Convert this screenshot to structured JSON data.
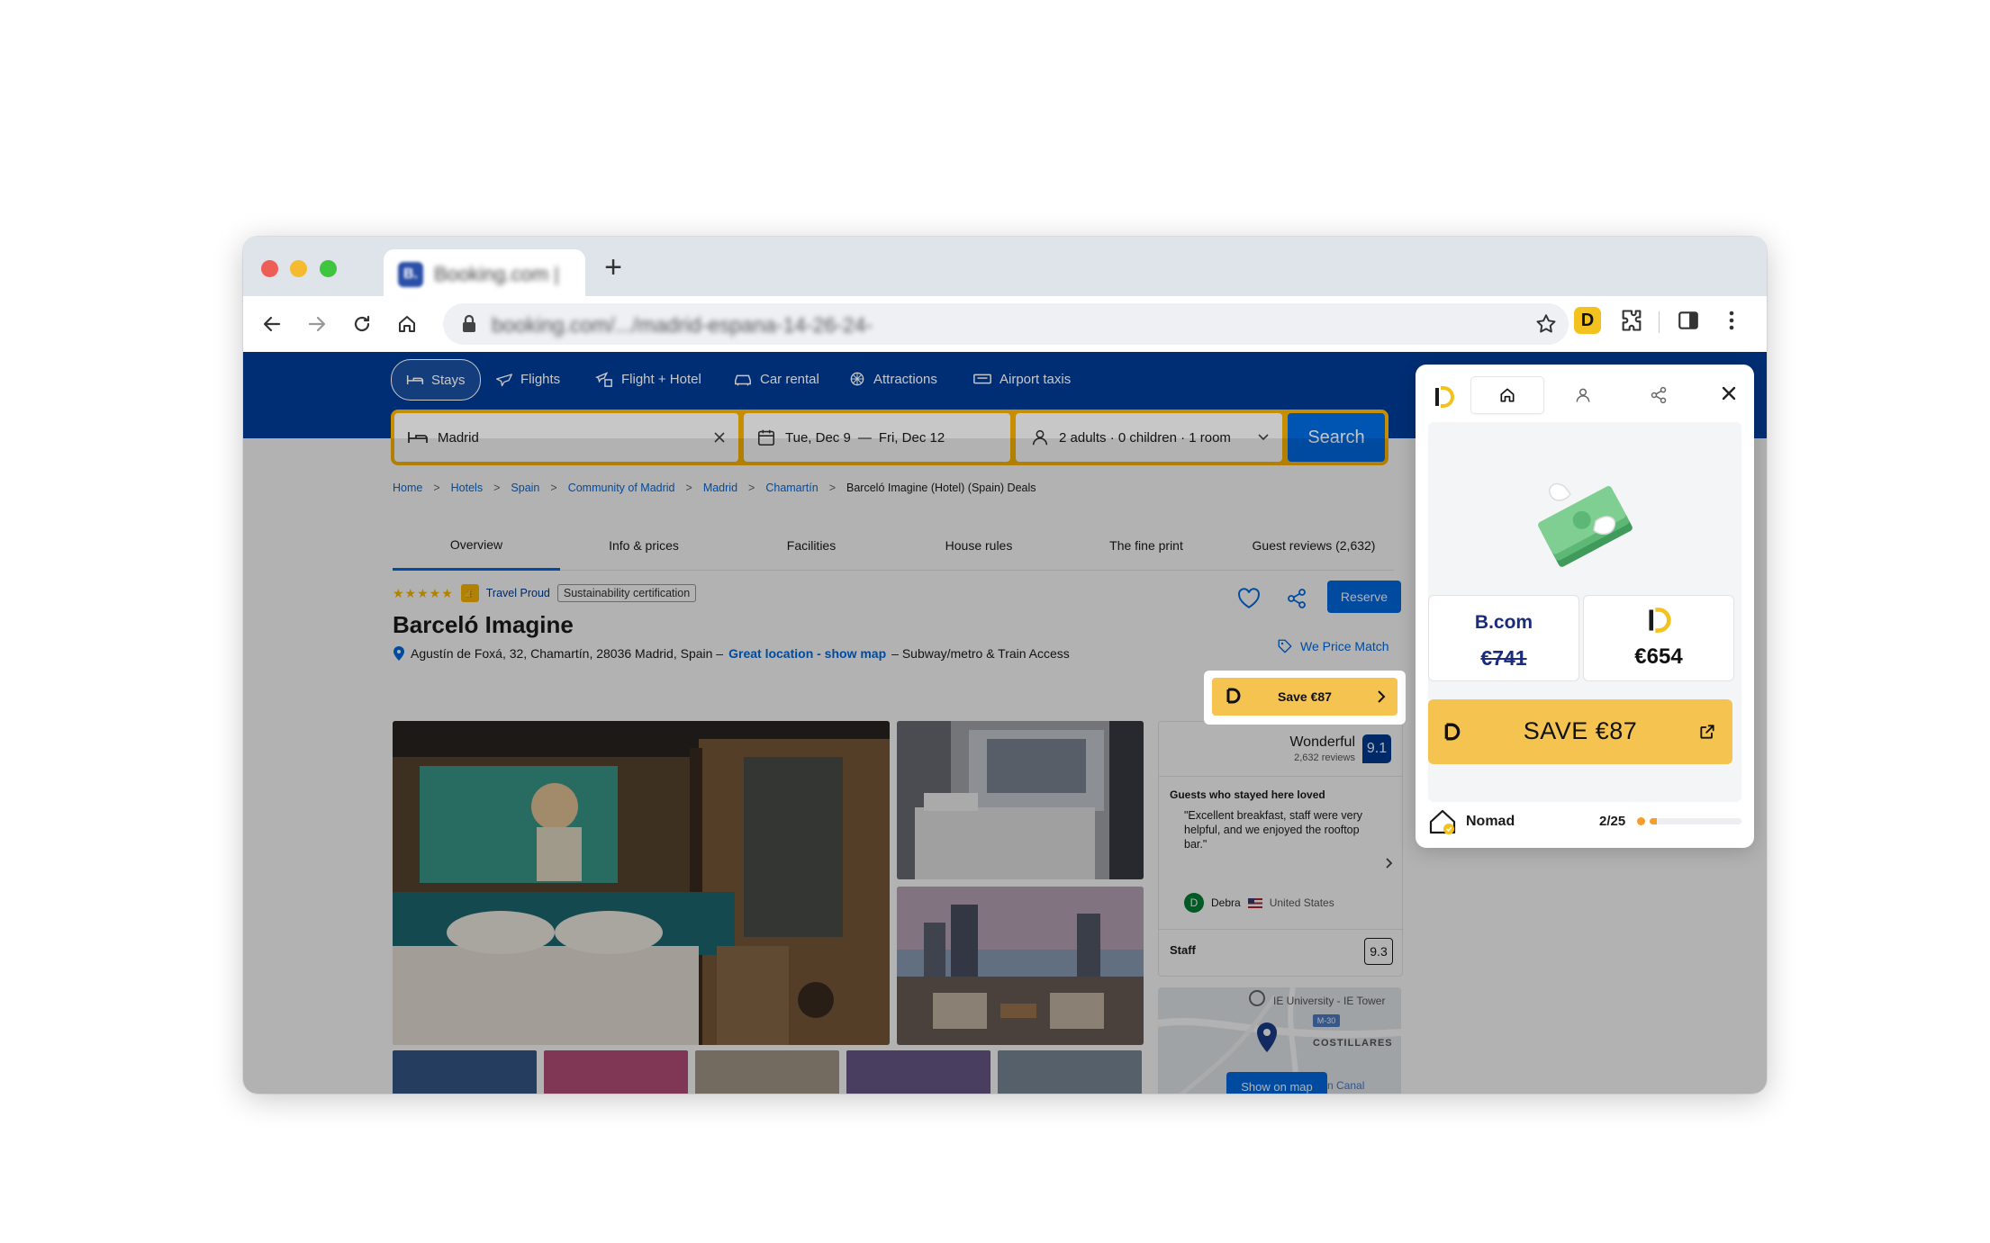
{
  "browser": {
    "tab_title": "Booking.com |",
    "tab_favicon": "B.",
    "url": "booking.com/.../madrid-espana-14-26-24-",
    "extension_letter": "D"
  },
  "header": {
    "nav": [
      {
        "label": "Stays",
        "icon": "bed-icon"
      },
      {
        "label": "Flights",
        "icon": "plane-icon"
      },
      {
        "label": "Flight + Hotel",
        "icon": "flight-hotel-icon"
      },
      {
        "label": "Car rental",
        "icon": "car-icon"
      },
      {
        "label": "Attractions",
        "icon": "attractions-icon"
      },
      {
        "label": "Airport taxis",
        "icon": "taxi-icon"
      }
    ],
    "search": {
      "destination": "Madrid",
      "dates_from": "Tue, Dec 9",
      "dates_sep": "—",
      "dates_to": "Fri, Dec 12",
      "guests": "2 adults · 0 children · 1 room",
      "button": "Search"
    }
  },
  "breadcrumb": [
    "Home",
    "Hotels",
    "Spain",
    "Community of Madrid",
    "Madrid",
    "Chamartín"
  ],
  "breadcrumb_last": "Barceló Imagine (Hotel) (Spain) Deals",
  "tabs": [
    "Overview",
    "Info & prices",
    "Facilities",
    "House rules",
    "The fine print",
    "Guest reviews (2,632)"
  ],
  "hotel": {
    "stars": "★★★★★",
    "thumbs_badge": "👍",
    "travel_proud": "Travel Proud",
    "sustainability": "Sustainability certification",
    "name": "Barceló Imagine",
    "address": "Agustín de Foxá, 32, Chamartín, 28036 Madrid, Spain –",
    "location_link": "Great location - show map",
    "address_suffix": "– Subway/metro & Train Access",
    "reserve": "Reserve",
    "price_match": "We Price Match",
    "save_inline": "Save €87"
  },
  "reviews": {
    "rating_word": "Wonderful",
    "count": "2,632 reviews",
    "score": "9.1",
    "heading": "Guests who stayed here loved",
    "quote": "\"Excellent breakfast, staff were very helpful, and we enjoyed the rooftop bar.\"",
    "reviewer_initial": "D",
    "reviewer": "Debra",
    "country": "United States",
    "staff_label": "Staff",
    "staff_score": "9.3"
  },
  "map": {
    "label1": "IE University - IE Tower",
    "road": "M-30",
    "label2": "COSTILLARES",
    "label3": "n Canal",
    "button": "Show on map"
  },
  "popup": {
    "tabs": [
      "home-icon",
      "user-icon",
      "share-icon"
    ],
    "left_brand": "B.com",
    "old_price": "€741",
    "new_price": "€654",
    "cta": "SAVE €87",
    "level": "Nomad",
    "progress_text": "2/25",
    "progress_fraction": 0.08
  },
  "colors": {
    "booking_blue": "#003b95",
    "search_yellow": "#ffb700",
    "cta_yellow": "#f5c34f",
    "progress_orange": "#f59e2b"
  }
}
